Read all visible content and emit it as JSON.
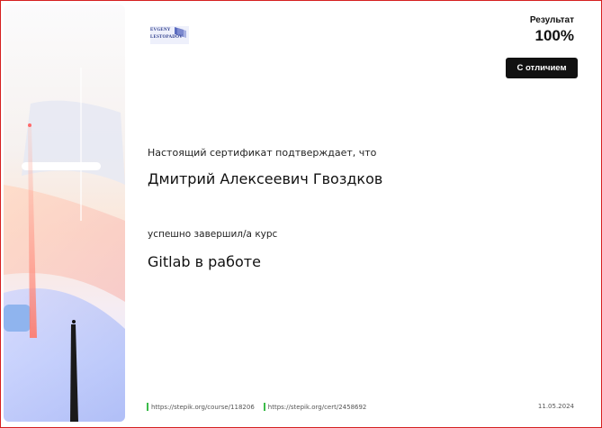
{
  "logo": {
    "line1": "EVGENY",
    "line2": "LESTOPADOV",
    "color": "#2a3a8a"
  },
  "result": {
    "label": "Результат",
    "value": "100%",
    "badge": "С отличием"
  },
  "certificate": {
    "intro": "Настоящий сертификат подтверждает, что",
    "recipient": "Дмитрий Алексеевич Гвоздков",
    "completed_text": "успешно завершил/а  курс",
    "course": "Gitlab в работе"
  },
  "footer": {
    "course_link": "https://stepik.org/course/118206",
    "cert_link": "https://stepik.org/cert/2458692",
    "date": "11.05.2024",
    "link_marker_color": "#3cbc4a"
  },
  "colors": {
    "border": "#d62020",
    "badge_bg": "#111111"
  }
}
